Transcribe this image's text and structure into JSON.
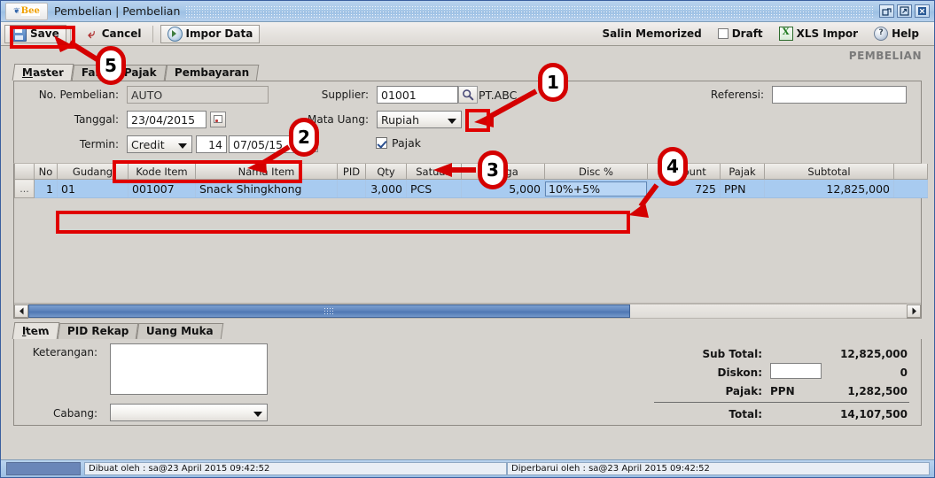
{
  "window": {
    "title": "Pembelian | Pembelian",
    "logo_text": "Bee",
    "restore_icon": "restore-icon",
    "maximize_icon": "maximize-icon",
    "close_icon": "close-icon"
  },
  "toolbar": {
    "save_label": "Save",
    "cancel_label": "Cancel",
    "impor_label": "Impor Data",
    "salin_memorized_label": "Salin Memorized",
    "draft_label": "Draft",
    "xls_impor_label": "XLS Impor",
    "xls_icon_text": "X",
    "help_label": "Help",
    "help_icon_text": "?"
  },
  "module_caption": "PEMBELIAN",
  "tabs": [
    {
      "label": "Master",
      "active": true
    },
    {
      "label": "Faktur Pajak",
      "active": false
    },
    {
      "label": "Pembayaran",
      "active": false
    }
  ],
  "form": {
    "no_pembelian_label": "No. Pembelian:",
    "no_pembelian_value": "AUTO",
    "tanggal_label": "Tanggal:",
    "tanggal_value": "23/04/2015",
    "termin_label": "Termin:",
    "termin_type": "Credit",
    "termin_days": "14",
    "termin_date": "07/05/15",
    "supplier_label": "Supplier:",
    "supplier_code": "01001",
    "supplier_name": "PT.ABC",
    "mata_uang_label": "Mata Uang:",
    "mata_uang_value": "Rupiah",
    "pajak_label": "Pajak",
    "pajak_checked": true,
    "referensi_label": "Referensi:",
    "referensi_value": ""
  },
  "grid": {
    "columns": [
      "No",
      "Gudang",
      "Kode Item",
      "Nama Item",
      "PID",
      "Qty",
      "Satuan",
      "Harga",
      "Disc %",
      "Discount",
      "Pajak",
      "Subtotal"
    ],
    "rows": [
      {
        "marker": "...",
        "no": "1",
        "gudang": "01",
        "kode_item": "001007",
        "nama_item": "Snack Shingkhong",
        "pid": "",
        "qty": "3,000",
        "satuan": "PCS",
        "harga": "5,000",
        "disc_pct": "10%+5%",
        "discount": "725",
        "pajak": "PPN",
        "subtotal": "12,825,000",
        "tail": ""
      }
    ]
  },
  "lower_tabs": [
    {
      "label": "Item",
      "active": true
    },
    {
      "label": "PID Rekap",
      "active": false
    },
    {
      "label": "Uang Muka",
      "active": false
    }
  ],
  "bottom": {
    "keterangan_label": "Keterangan:",
    "keterangan_value": "",
    "cabang_label": "Cabang:",
    "cabang_value": "",
    "sub_total_label": "Sub Total:",
    "sub_total_value": "12,825,000",
    "diskon_label": "Diskon:",
    "diskon_input": "",
    "diskon_value": "0",
    "pajak_label": "Pajak:",
    "pajak_type": "PPN",
    "pajak_value": "1,282,500",
    "total_label": "Total:",
    "total_value": "14,107,500"
  },
  "status": {
    "created": "Dibuat oleh : sa@23 April 2015  09:42:52",
    "updated": "Diperbarui oleh : sa@23 April 2015  09:42:52"
  },
  "annotations": {
    "callout_1": "1",
    "callout_2": "2",
    "callout_3": "3",
    "callout_4": "4",
    "callout_5": "5"
  },
  "colors": {
    "accent_red": "#d40000",
    "titlebar_blue": "#a8c8e8",
    "row_select_blue": "#a8cbf0",
    "panel_gray": "#d6d3ce"
  }
}
